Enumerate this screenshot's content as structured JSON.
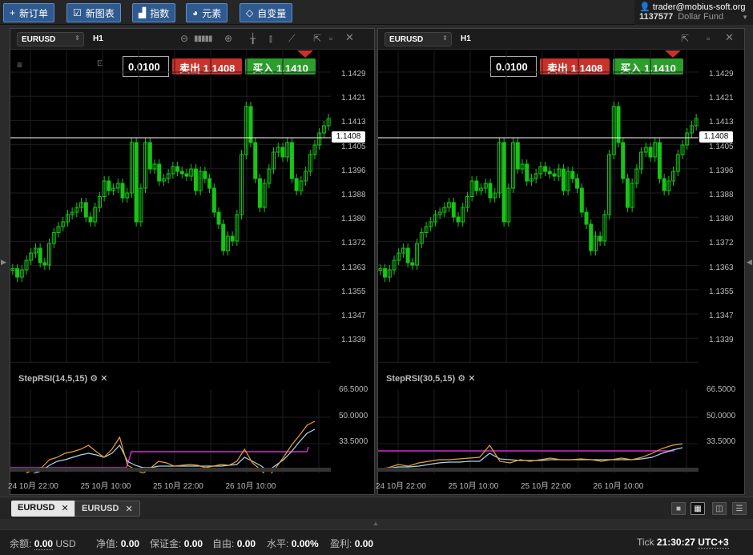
{
  "toolbar": {
    "new_order": "新订单",
    "new_chart": "新图表",
    "indicators": "指数",
    "elements": "元素",
    "variables": "自变量",
    "icons": {
      "new_order": "plus-icon",
      "new_chart": "chart-check-icon",
      "indicators": "bar-chart-icon",
      "elements": "shapes-icon",
      "variables": "diamond-icon"
    }
  },
  "account": {
    "email": "trader@mobius-soft.org",
    "number": "1137577",
    "fund": "Dollar Fund"
  },
  "charts": [
    {
      "symbol": "EURUSD",
      "timeframe": "H1",
      "quantity": "0.0100",
      "sell_label": "卖出",
      "sell_price": "1.1408",
      "buy_label": "买入",
      "buy_price": "1.1410",
      "current_price": "1.1408",
      "price_ticks": [
        "1.1429",
        "1.1421",
        "1.1413",
        "1.1405",
        "1.1396",
        "1.1388",
        "1.1380",
        "1.1372",
        "1.1363",
        "1.1355",
        "1.1347",
        "1.1339"
      ],
      "indicator_title": "StepRSI(14,5,15)",
      "indicator_ticks": [
        "66.5000",
        "50.0000",
        "33.5000"
      ],
      "time_labels": [
        "24 10月 22:00",
        "25 10月 10:00",
        "25 10月 22:00",
        "26 10月 10:00"
      ]
    },
    {
      "symbol": "EURUSD",
      "timeframe": "H1",
      "quantity": "0.0100",
      "sell_label": "卖出",
      "sell_price": "1.1408",
      "buy_label": "买入",
      "buy_price": "1.1410",
      "current_price": "1.1408",
      "price_ticks": [
        "1.1429",
        "1.1421",
        "1.1413",
        "1.1405",
        "1.1396",
        "1.1388",
        "1.1380",
        "1.1372",
        "1.1363",
        "1.1355",
        "1.1347",
        "1.1339"
      ],
      "indicator_title": "StepRSI(30,5,15)",
      "indicator_ticks": [
        "66.5000",
        "50.0000",
        "33.5000"
      ],
      "time_labels": [
        "24 10月 22:00",
        "25 10月 10:00",
        "25 10月 22:00",
        "26 10月 10:00"
      ]
    }
  ],
  "tabs": [
    {
      "label": "EURUSD",
      "active": true
    },
    {
      "label": "EURUSD",
      "active": false
    }
  ],
  "status": {
    "balance_label": "余额:",
    "balance": "0.00",
    "currency": "USD",
    "equity_label": "净值:",
    "equity": "0.00",
    "margin_label": "保证金:",
    "margin": "0.00",
    "free_label": "自由:",
    "free": "0.00",
    "level_label": "水平:",
    "level": "0.00%",
    "profit_label": "盈利:",
    "profit": "0.00",
    "tick_label": "Tick",
    "time": "21:30:27",
    "timezone": "UTC+3"
  },
  "colors": {
    "up": "#17c417",
    "sell": "#c9322b",
    "buy": "#2c9e2c",
    "signal": "#d62ad6",
    "rsi_fast": "#f0a030",
    "rsi_slow": "#a8d8f0"
  }
}
